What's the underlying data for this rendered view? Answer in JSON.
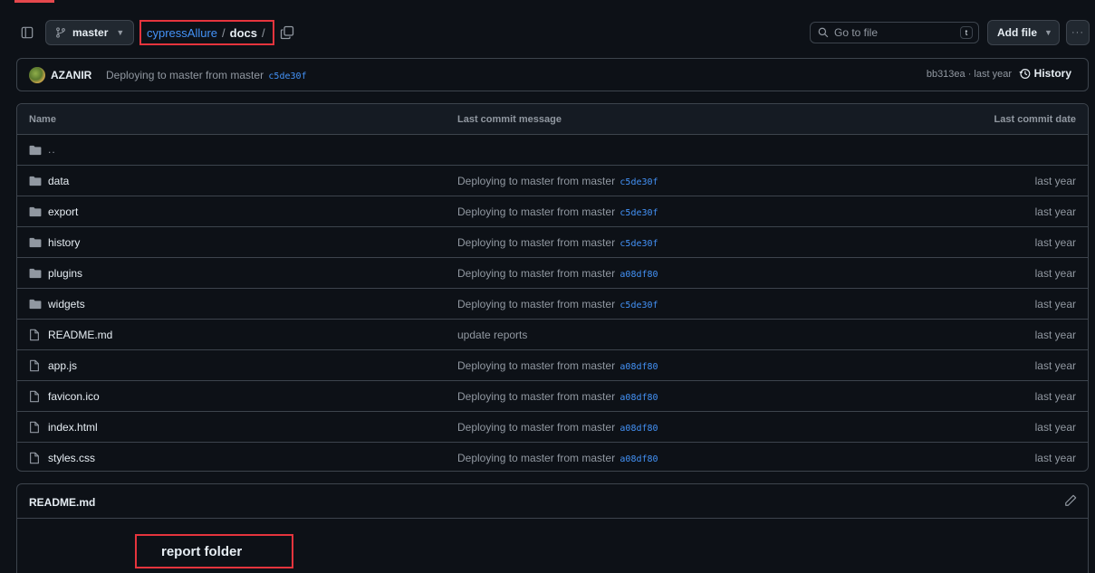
{
  "toolbar": {
    "branch": "master",
    "breadcrumb_repo": "cypressAllure",
    "breadcrumb_sep1": "/",
    "breadcrumb_dir": "docs",
    "breadcrumb_sep2": "/",
    "search_placeholder": "Go to file",
    "search_shortcut": "t",
    "add_file_label": "Add file",
    "more_label": "···"
  },
  "latest_commit": {
    "author": "AZANIR",
    "message": "Deploying to master from master",
    "message_sha": "c5de30f",
    "commit_meta": "bb313ea · last year",
    "history_label": "History"
  },
  "table": {
    "headers": {
      "name": "Name",
      "message": "Last commit message",
      "date": "Last commit date"
    },
    "parent_label": "..",
    "rows": [
      {
        "type": "folder",
        "name": "data",
        "message": "Deploying to master from master",
        "sha": "c5de30f",
        "date": "last year"
      },
      {
        "type": "folder",
        "name": "export",
        "message": "Deploying to master from master",
        "sha": "c5de30f",
        "date": "last year"
      },
      {
        "type": "folder",
        "name": "history",
        "message": "Deploying to master from master",
        "sha": "c5de30f",
        "date": "last year"
      },
      {
        "type": "folder",
        "name": "plugins",
        "message": "Deploying to master from master",
        "sha": "a08df80",
        "date": "last year"
      },
      {
        "type": "folder",
        "name": "widgets",
        "message": "Deploying to master from master",
        "sha": "c5de30f",
        "date": "last year"
      },
      {
        "type": "file",
        "name": "README.md",
        "message": "update reports",
        "sha": "",
        "date": "last year"
      },
      {
        "type": "file",
        "name": "app.js",
        "message": "Deploying to master from master",
        "sha": "a08df80",
        "date": "last year"
      },
      {
        "type": "file",
        "name": "favicon.ico",
        "message": "Deploying to master from master",
        "sha": "a08df80",
        "date": "last year"
      },
      {
        "type": "file",
        "name": "index.html",
        "message": "Deploying to master from master",
        "sha": "a08df80",
        "date": "last year"
      },
      {
        "type": "file",
        "name": "styles.css",
        "message": "Deploying to master from master",
        "sha": "a08df80",
        "date": "last year"
      }
    ]
  },
  "readme": {
    "title": "README.md",
    "content": "report folder"
  },
  "colors": {
    "background": "#0d1117",
    "border": "#3d444d",
    "link": "#4493f8",
    "muted": "#9198a1",
    "highlight": "#e5343d"
  }
}
